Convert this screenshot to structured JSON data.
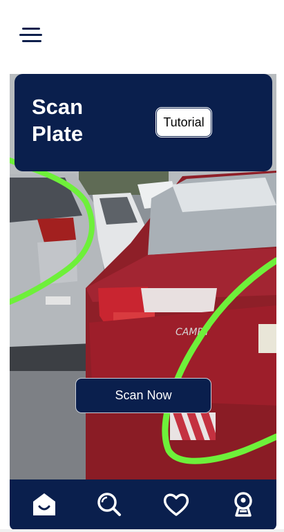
{
  "header": {
    "title": "Scan\nPlate",
    "tutorial_label": "Tutorial"
  },
  "camera": {
    "scan_label": "Scan Now",
    "badge_text": "CAMRY"
  },
  "nav": {
    "items": [
      {
        "icon": "home-icon"
      },
      {
        "icon": "search-icon"
      },
      {
        "icon": "heart-icon"
      },
      {
        "icon": "profile-icon"
      }
    ]
  },
  "colors": {
    "primary": "#0a1f4d",
    "highlight": "#6ef03a",
    "white": "#ffffff"
  }
}
